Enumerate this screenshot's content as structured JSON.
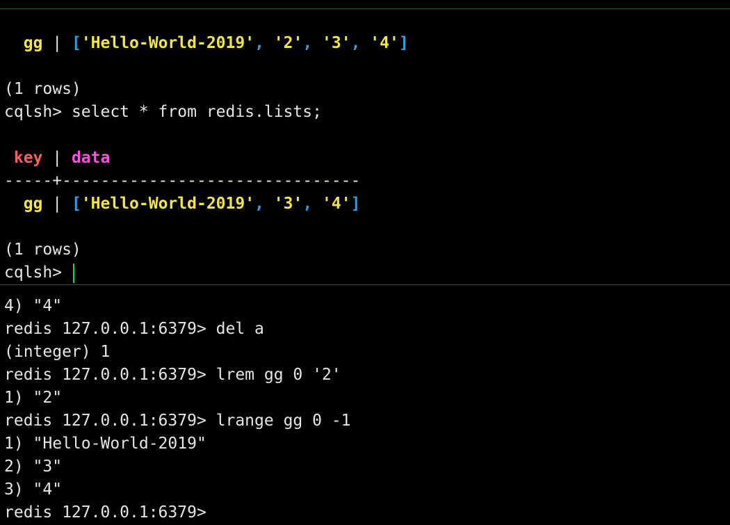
{
  "cql_pane": {
    "row1": {
      "key": "gg",
      "sep": " | ",
      "open": "[",
      "items": [
        "'Hello-World-2019'",
        "'2'",
        "'3'",
        "'4'"
      ],
      "comma": ", ",
      "close": "]"
    },
    "rows_count_1": "(1 rows)",
    "prompt_1": "cqlsh> ",
    "command": "select * from redis.lists;",
    "header": {
      "key": "key",
      "sep": " | ",
      "data": "data"
    },
    "divider": "-----+-------------------------------",
    "row2": {
      "key": "gg",
      "sep": " | ",
      "open": "[",
      "items": [
        "'Hello-World-2019'",
        "'3'",
        "'4'"
      ],
      "comma": ", ",
      "close": "]"
    },
    "rows_count_2": "(1 rows)",
    "prompt_2": "cqlsh> "
  },
  "redis_pane": {
    "lines": [
      "4) \"4\"",
      "redis 127.0.0.1:6379> del a",
      "(integer) 1",
      "redis 127.0.0.1:6379> lrem gg 0 '2'",
      "1) \"2\"",
      "redis 127.0.0.1:6379> lrange gg 0 -1",
      "1) \"Hello-World-2019\"",
      "2) \"3\"",
      "3) \"4\"",
      "redis 127.0.0.1:6379> "
    ]
  },
  "colors": {
    "background": "#000000",
    "text": "#e6e6e6",
    "yellow": "#f4e547",
    "blue": "#2f9fe6",
    "red": "#ff5c5c",
    "magenta": "#ff4fe0",
    "cursor": "#1fd34a",
    "pane_border": "#1f5c2a"
  }
}
